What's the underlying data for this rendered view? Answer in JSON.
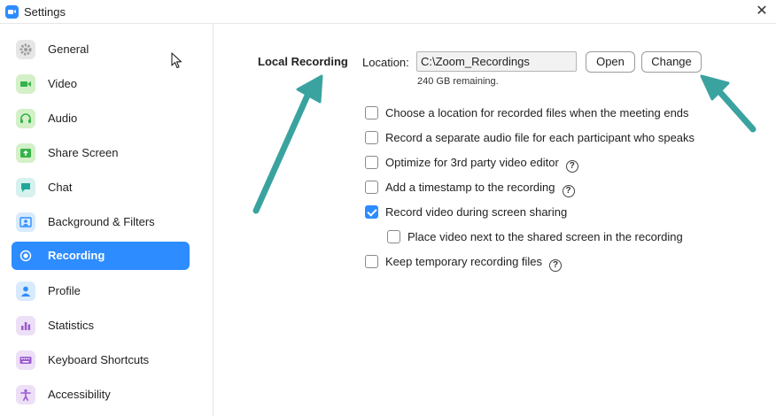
{
  "window": {
    "title": "Settings",
    "close_glyph": "✕"
  },
  "sidebar": {
    "items": [
      {
        "label": "General",
        "icon": "gear-icon",
        "color": "#e6e6e6"
      },
      {
        "label": "Video",
        "icon": "video-camera-icon",
        "color": "#d3f0c8"
      },
      {
        "label": "Audio",
        "icon": "headphones-icon",
        "color": "#d3f0c8"
      },
      {
        "label": "Share Screen",
        "icon": "share-screen-icon",
        "color": "#d3f0c8"
      },
      {
        "label": "Chat",
        "icon": "chat-bubble-icon",
        "color": "#d6f1ee"
      },
      {
        "label": "Background & Filters",
        "icon": "person-frame-icon",
        "color": "#d8eafd"
      },
      {
        "label": "Recording",
        "icon": "record-icon",
        "color": "#2d8cff",
        "active": true
      },
      {
        "label": "Profile",
        "icon": "user-icon",
        "color": "#d8eafd"
      },
      {
        "label": "Statistics",
        "icon": "bar-chart-icon",
        "color": "#ecdff7"
      },
      {
        "label": "Keyboard Shortcuts",
        "icon": "keyboard-icon",
        "color": "#ecdff7"
      },
      {
        "label": "Accessibility",
        "icon": "accessibility-icon",
        "color": "#ecdff7"
      }
    ]
  },
  "recording": {
    "section_title": "Local Recording",
    "location_label": "Location:",
    "location_value": "C:\\Zoom_Recordings",
    "open_label": "Open",
    "change_label": "Change",
    "remaining": "240 GB remaining.",
    "options": [
      {
        "label": "Choose a location for recorded files when the meeting ends",
        "checked": false,
        "help": false
      },
      {
        "label": "Record a separate audio file for each participant who speaks",
        "checked": false,
        "help": false
      },
      {
        "label": "Optimize for 3rd party video editor",
        "checked": false,
        "help": true
      },
      {
        "label": "Add a timestamp to the recording",
        "checked": false,
        "help": true
      },
      {
        "label": "Record video during screen sharing",
        "checked": true,
        "help": false
      },
      {
        "label": "Place video next to the shared screen in the recording",
        "checked": false,
        "help": false,
        "indent": true
      },
      {
        "label": "Keep temporary recording files",
        "checked": false,
        "help": true
      }
    ],
    "help_glyph": "?"
  },
  "colors": {
    "accent": "#2d8cff",
    "annotation_arrow": "#3aa3a0"
  }
}
